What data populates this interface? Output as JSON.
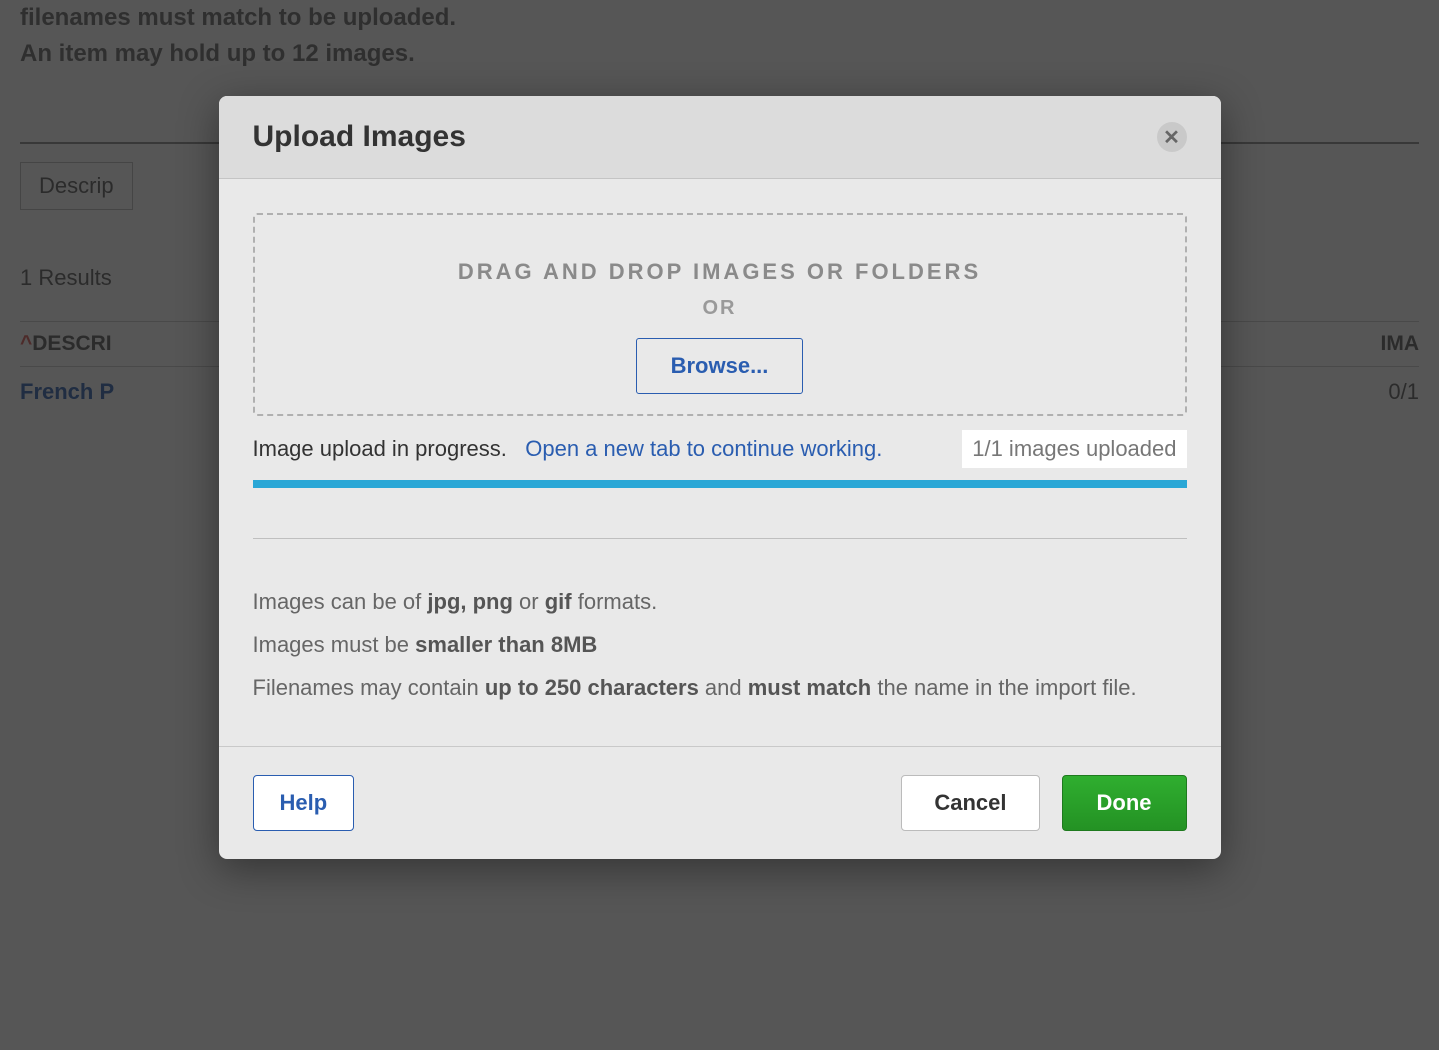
{
  "background": {
    "hint_line1": "filenames must match to be uploaded.",
    "hint_line2": "An item may hold up to 12 images.",
    "search_label": "Descrip",
    "results_text": "1 Results",
    "col_desc_caret": "^",
    "col_desc": "DESCRI",
    "col_images": "IMA",
    "row_desc": "French P",
    "row_images": "0/1"
  },
  "modal": {
    "title": "Upload Images",
    "close_symbol": "✕",
    "dropzone": {
      "line1": "DRAG AND DROP IMAGES OR FOLDERS",
      "or": "OR",
      "browse": "Browse..."
    },
    "progress": {
      "text": "Image upload in progress.",
      "link": "Open a new tab to continue working.",
      "count": "1/1 images uploaded"
    },
    "rules": {
      "line1_a": "Images can be of ",
      "line1_b": "jpg, png",
      "line1_c": " or ",
      "line1_d": "gif",
      "line1_e": " formats.",
      "line2_a": "Images must be ",
      "line2_b": "smaller than 8MB",
      "line3_a": "Filenames may contain ",
      "line3_b": "up to 250 characters",
      "line3_c": " and ",
      "line3_d": "must match",
      "line3_e": " the name in the import file."
    },
    "footer": {
      "help": "Help",
      "cancel": "Cancel",
      "done": "Done"
    }
  }
}
